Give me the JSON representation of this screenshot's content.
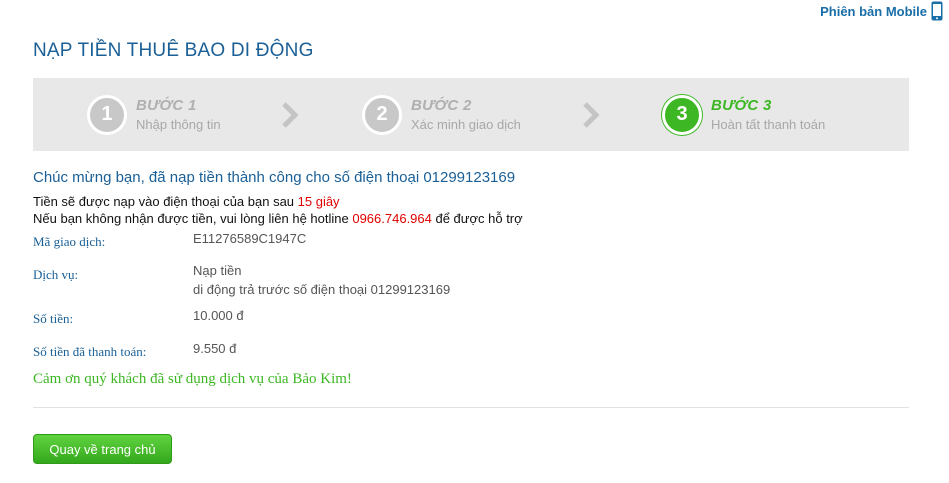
{
  "header": {
    "mobile_link": "Phiên bản Mobile",
    "mobile_icon": "mobile-phone-icon"
  },
  "page": {
    "title": "NẠP TIỀN THUÊ BAO DI ĐỘNG"
  },
  "steps": [
    {
      "number": "1",
      "title": "BƯỚC 1",
      "subtitle": "Nhập thông tin",
      "active": false
    },
    {
      "number": "2",
      "title": "BƯỚC 2",
      "subtitle": "Xác minh giao dịch",
      "active": false
    },
    {
      "number": "3",
      "title": "BƯỚC 3",
      "subtitle": "Hoàn tất thanh toán",
      "active": true
    }
  ],
  "result": {
    "success_message": "Chúc mừng bạn, đã nạp tiền thành công cho số điện thoại 01299123169",
    "topup_notice_prefix": "Tiền sẽ được nạp vào điện thoại của bạn sau ",
    "topup_notice_time": "15 giây",
    "support_prefix": "Nếu bạn không nhận được tiền, vui lòng liên hệ hotline ",
    "hotline": "0966.746.964",
    "support_suffix": " để được hỗ trợ"
  },
  "details": {
    "transaction_label": "Mã giao dịch:",
    "transaction_value": "E11276589C1947C",
    "service_label": "Dịch vụ:",
    "service_value_line1": "Nạp tiền",
    "service_value_line2": "di động trả trước số điện thoại 01299123169",
    "amount_label": "Số tiền:",
    "amount_value": "10.000 đ",
    "paid_label": "Số tiền đã thanh toán:",
    "paid_value": "9.550 đ"
  },
  "thanks": "Cảm ơn quý khách đã sử dụng dịch vụ của Bảo Kim!",
  "actions": {
    "home_button": "Quay về trang chủ"
  },
  "colors": {
    "brand_blue": "#1a5f96",
    "success_green": "#3db824",
    "alert_red": "#e00000",
    "step_bar": "#e8e8e8"
  }
}
